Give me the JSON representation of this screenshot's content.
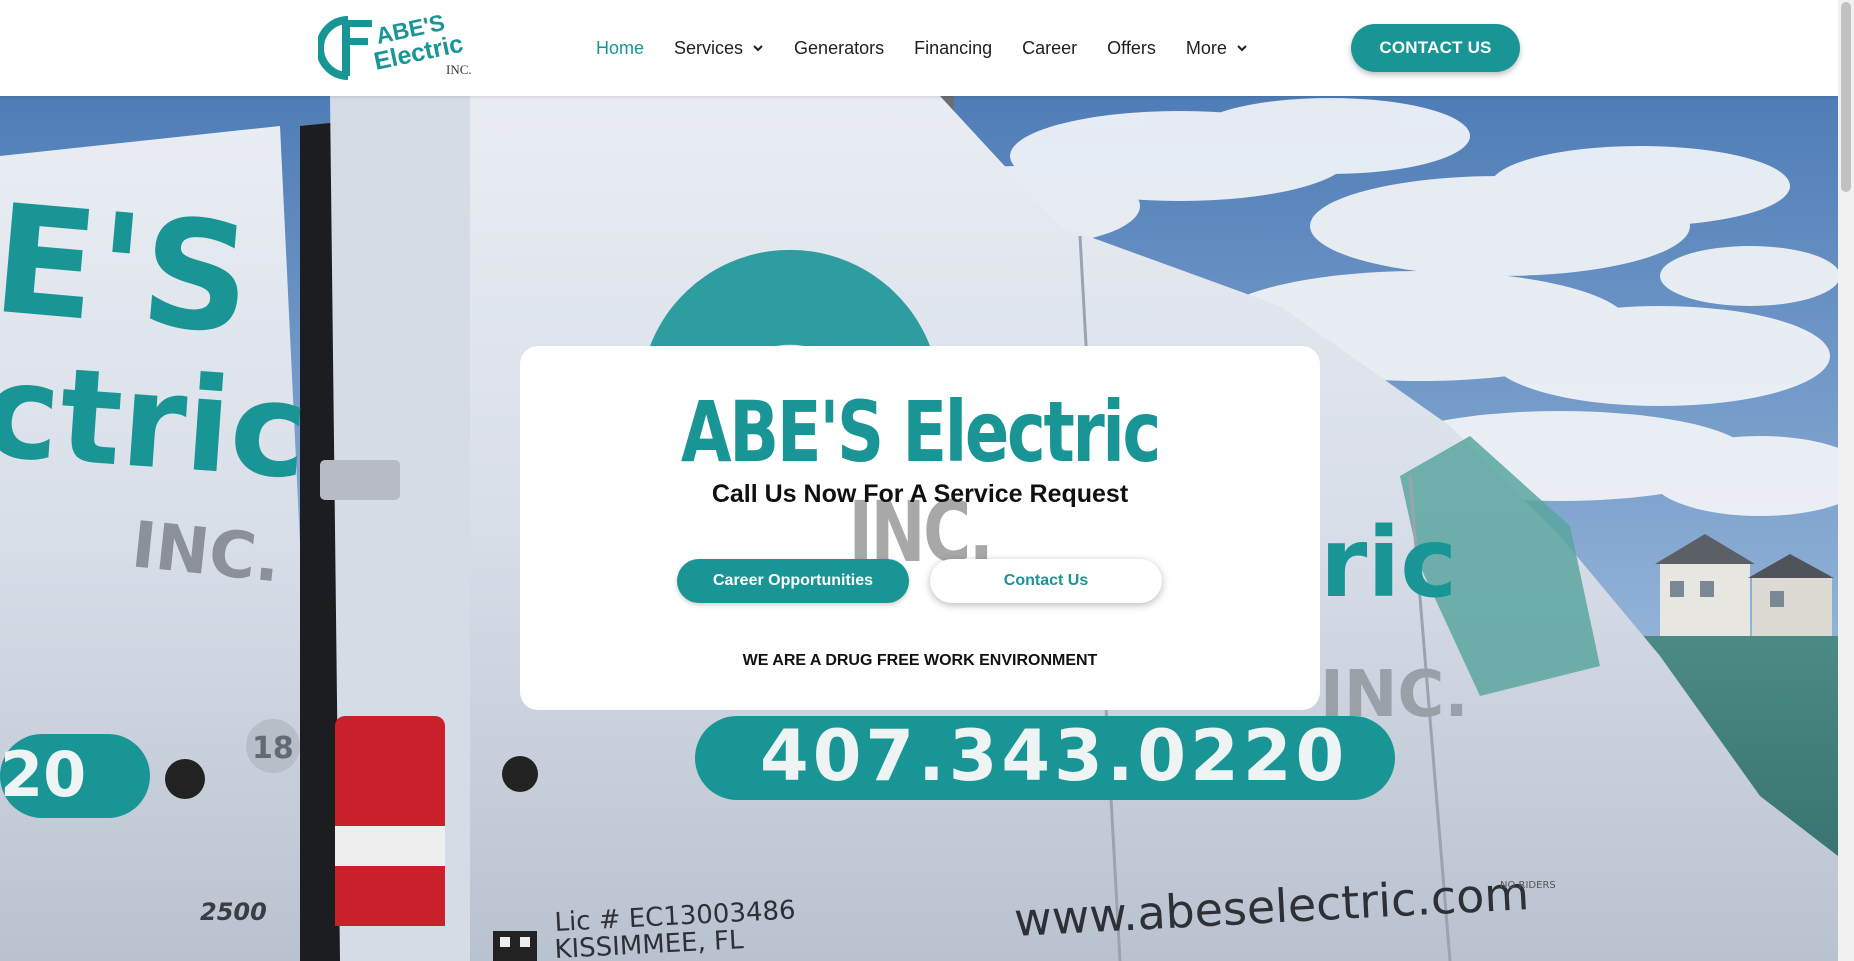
{
  "header": {
    "logo": {
      "line1": "ABE'S",
      "line2": "Electric",
      "line3": "INC."
    },
    "nav": [
      {
        "label": "Home",
        "active": true,
        "dropdown": false
      },
      {
        "label": "Services",
        "active": false,
        "dropdown": true
      },
      {
        "label": "Generators",
        "active": false,
        "dropdown": false
      },
      {
        "label": "Financing",
        "active": false,
        "dropdown": false
      },
      {
        "label": "Career",
        "active": false,
        "dropdown": false
      },
      {
        "label": "Offers",
        "active": false,
        "dropdown": false
      },
      {
        "label": "More",
        "active": false,
        "dropdown": true
      }
    ],
    "cta_label": "CONTACT US"
  },
  "hero": {
    "van": {
      "side_brand_1": "E'S",
      "side_brand_2": "ctric",
      "side_inc": "INC.",
      "phone_partial": "20",
      "unit_number": "18",
      "model": "2500",
      "main_brand": "ric",
      "main_inc": "INC.",
      "phone": "407.343.0220",
      "website": "www.abeselectric.com",
      "license": "Lic # EC13003486",
      "city": "KISSIMMEE, FL",
      "no_riders": "NO RIDERS"
    }
  },
  "card": {
    "title_primary": "ABE'S Electric",
    "title_secondary": "INC.",
    "subtitle": "Call Us Now For A Service Request",
    "btn_primary": "Career Opportunities",
    "btn_secondary": "Contact Us",
    "note": "WE ARE A DRUG FREE WORK ENVIRONMENT"
  },
  "colors": {
    "brand_teal": "#1a9596",
    "inc_gray": "#a8a8a8",
    "text_dark": "#1f1f1f"
  },
  "icons": {
    "nav_dropdown": "chevron-down-icon",
    "logo_mark": "abes-logo-icon"
  }
}
